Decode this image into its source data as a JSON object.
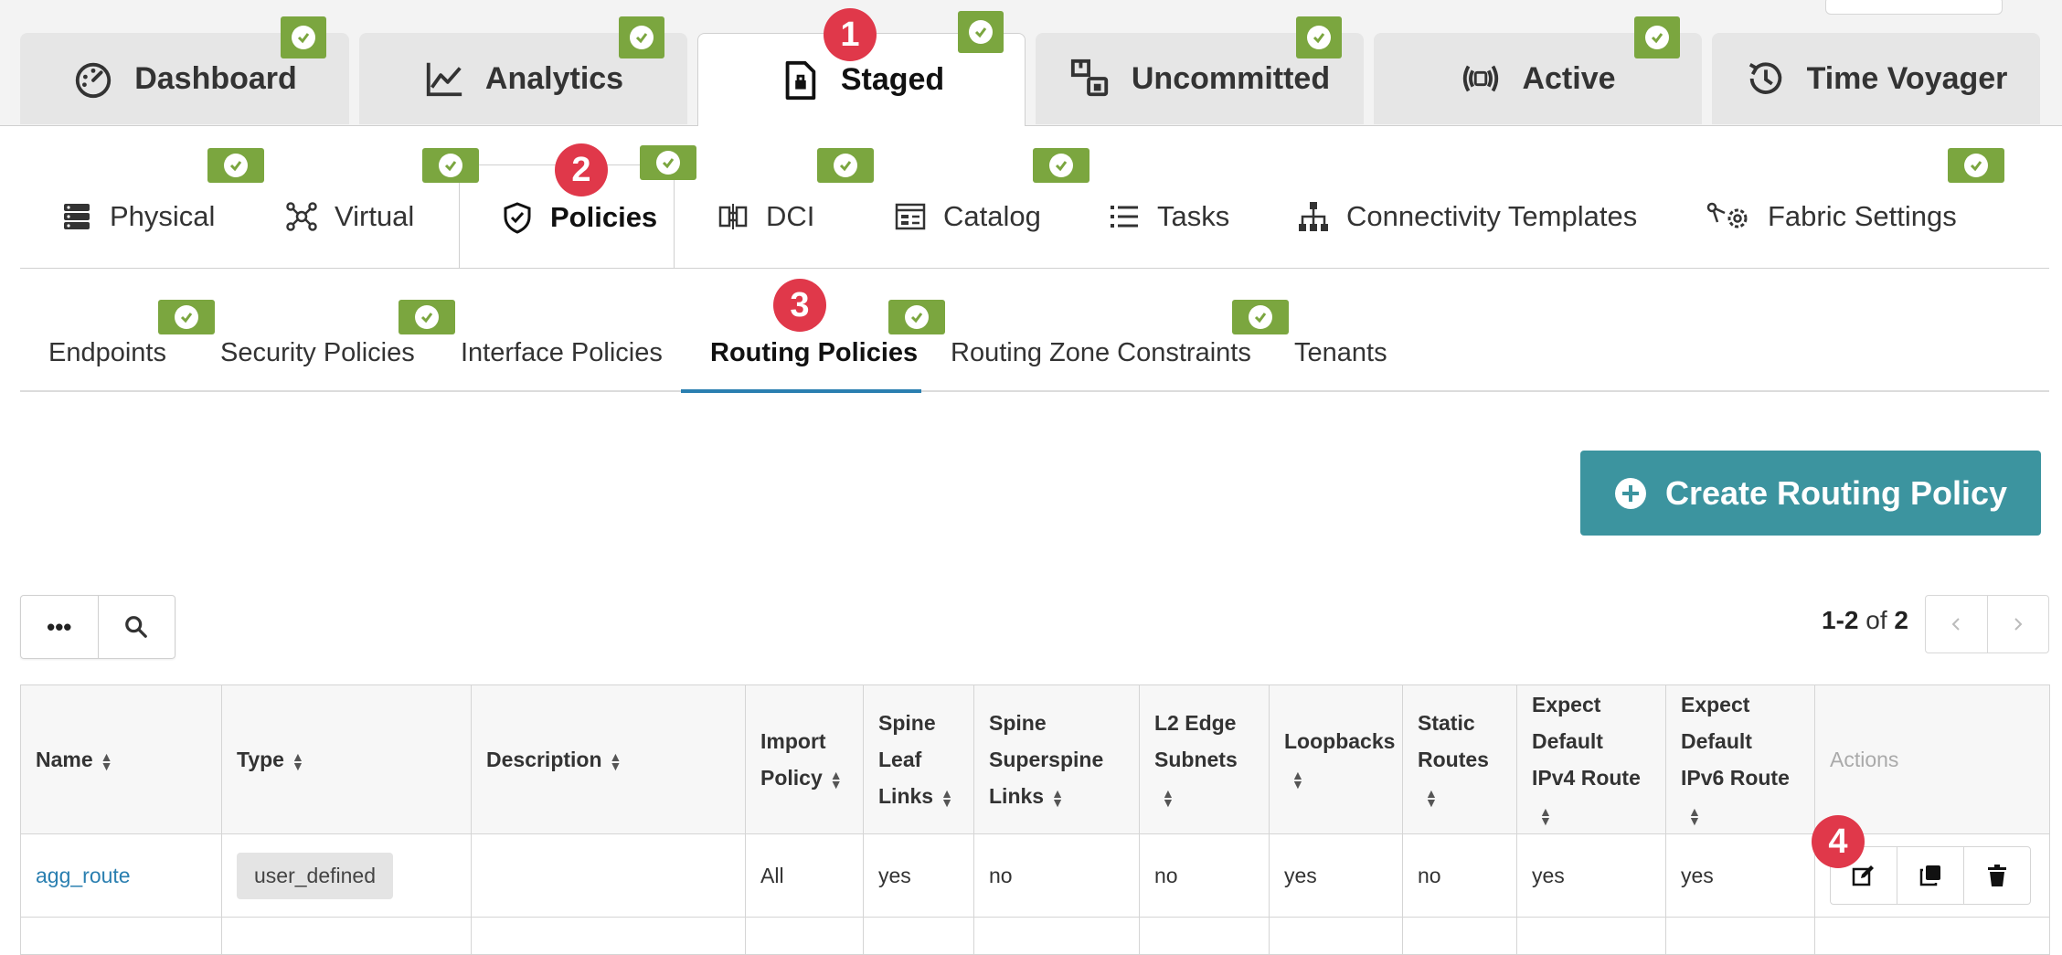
{
  "top_tabs": [
    {
      "label": "Dashboard"
    },
    {
      "label": "Analytics"
    },
    {
      "label": "Staged"
    },
    {
      "label": "Uncommitted"
    },
    {
      "label": "Active"
    },
    {
      "label": "Time Voyager"
    }
  ],
  "sub_tabs": [
    {
      "label": "Physical"
    },
    {
      "label": "Virtual"
    },
    {
      "label": "Policies"
    },
    {
      "label": "DCI"
    },
    {
      "label": "Catalog"
    },
    {
      "label": "Tasks"
    },
    {
      "label": "Connectivity Templates"
    },
    {
      "label": "Fabric Settings"
    }
  ],
  "policy_tabs": [
    {
      "label": "Endpoints"
    },
    {
      "label": "Security Policies"
    },
    {
      "label": "Interface Policies"
    },
    {
      "label": "Routing Policies"
    },
    {
      "label": "Routing Zone Constraints"
    },
    {
      "label": "Tenants"
    }
  ],
  "step_badges": [
    "1",
    "2",
    "3",
    "4"
  ],
  "create_button": {
    "label": "Create Routing Policy"
  },
  "toolbar": {
    "more_label": "•••"
  },
  "pagination": {
    "range": "1-2",
    "of_label": "of",
    "total": "2"
  },
  "table": {
    "headers": {
      "name": "Name",
      "type": "Type",
      "description": "Description",
      "import_policy": "Import Policy",
      "spine_leaf": "Spine Leaf Links",
      "spine_superspine": "Spine Superspine Links",
      "l2_edge": "L2 Edge Subnets",
      "loopbacks": "Loopbacks",
      "static_routes": "Static Routes",
      "expect_ipv4": "Expect Default IPv4 Route",
      "expect_ipv6": "Expect Default IPv6 Route",
      "actions": "Actions"
    },
    "rows": [
      {
        "name": "agg_route",
        "type": "user_defined",
        "description": "",
        "import_policy": "All",
        "spine_leaf": "yes",
        "spine_superspine": "no",
        "l2_edge": "no",
        "loopbacks": "yes",
        "static_routes": "no",
        "expect_ipv4": "yes",
        "expect_ipv6": "yes"
      }
    ]
  },
  "colors": {
    "check_green": "#7ba63f",
    "badge_red": "#e0384a",
    "create_teal": "#3c949f",
    "link_blue": "#2a7fb0"
  },
  "icons": [
    "dashboard-gauge-icon",
    "analytics-chart-icon",
    "staged-doc-icon",
    "uncommitted-icon",
    "active-radio-icon",
    "time-voyager-history-icon",
    "physical-server-icon",
    "virtual-nodes-icon",
    "policies-shield-icon",
    "dci-icon",
    "catalog-icon",
    "tasks-list-icon",
    "connectivity-tree-icon",
    "fabric-settings-icon",
    "plus-circle-icon",
    "search-icon",
    "edit-icon",
    "clone-icon",
    "trash-icon",
    "check-circle-icon"
  ]
}
